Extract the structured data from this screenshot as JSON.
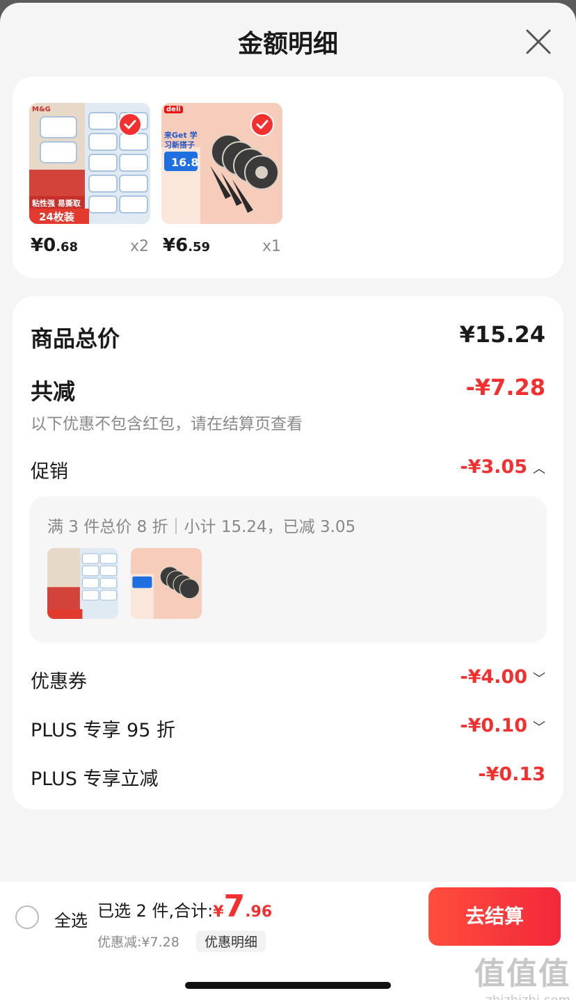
{
  "header": {
    "title": "金额明细"
  },
  "products": [
    {
      "brand": "M&G",
      "banner": "粘性强 易撕取",
      "count_label": "24枚装",
      "price_int": "¥0",
      "price_dec": ".68",
      "qty": "x2",
      "selected": true
    },
    {
      "brand": "deli",
      "promo": "来Get 学习新搭子",
      "promo_price": "16.8",
      "price_int": "¥6",
      "price_dec": ".59",
      "qty": "x1",
      "selected": true
    }
  ],
  "summary": {
    "total_label": "商品总价",
    "total_value": "¥15.24",
    "reduce_label": "共减",
    "reduce_value": "-¥7.28",
    "reduce_note": "以下优惠不包含红包，请在结算页查看",
    "promo_label": "促销",
    "promo_value": "-¥3.05",
    "promo_detail": "满 3 件总价 8 折｜小计 15.24，已减 3.05",
    "coupon_label": "优惠券",
    "coupon_value": "-¥4.00",
    "plus95_label": "PLUS 专享 95 折",
    "plus95_value": "-¥0.10",
    "pluscut_label": "PLUS 专享立减",
    "pluscut_value": "-¥0.13"
  },
  "bottom": {
    "select_all": "全选",
    "selected_info": "已选 2 件,合计:",
    "total_yen": "¥",
    "total_int": "7",
    "total_dec": ".96",
    "savings": "优惠减:¥7.28",
    "detail_link": "优惠明细",
    "checkout": "去结算"
  },
  "watermark": {
    "logo": "值值值",
    "site": "zhizhizhi.com"
  },
  "colors": {
    "accent": "#f23030",
    "background": "#f5f5f5",
    "card": "#ffffff"
  }
}
